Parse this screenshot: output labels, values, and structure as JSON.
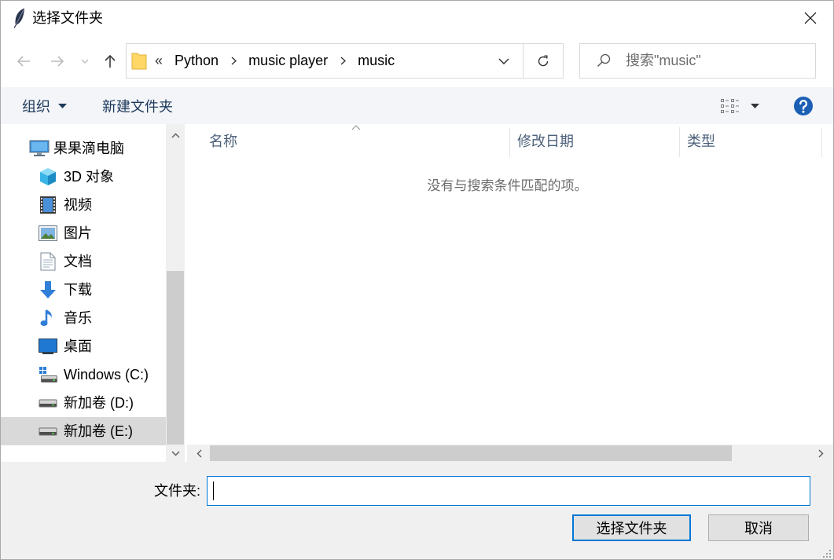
{
  "window": {
    "title": "选择文件夹"
  },
  "address": {
    "overflow": "«",
    "crumbs": [
      "Python",
      "music player",
      "music"
    ]
  },
  "search": {
    "placeholder": "搜索\"music\""
  },
  "toolbar": {
    "organize": "组织",
    "new_folder": "新建文件夹"
  },
  "nav": {
    "items": [
      {
        "label": "果果滴电脑",
        "icon": "computer-icon"
      },
      {
        "label": "3D 对象",
        "icon": "3d-objects-icon"
      },
      {
        "label": "视频",
        "icon": "videos-icon"
      },
      {
        "label": "图片",
        "icon": "pictures-icon"
      },
      {
        "label": "文档",
        "icon": "documents-icon"
      },
      {
        "label": "下载",
        "icon": "downloads-icon"
      },
      {
        "label": "音乐",
        "icon": "music-icon"
      },
      {
        "label": "桌面",
        "icon": "desktop-icon"
      },
      {
        "label": "Windows (C:)",
        "icon": "system-drive-icon"
      },
      {
        "label": "新加卷 (D:)",
        "icon": "drive-icon"
      },
      {
        "label": "新加卷 (E:)",
        "icon": "drive-icon",
        "selected": true
      }
    ]
  },
  "file_list": {
    "columns": [
      "名称",
      "修改日期",
      "类型"
    ],
    "empty_message": "没有与搜索条件匹配的项。"
  },
  "footer": {
    "folder_label": "文件夹:",
    "folder_value": "",
    "select_button": "选择文件夹",
    "cancel_button": "取消"
  },
  "colors": {
    "accent": "#0078d7",
    "selection": "#d9d9d9",
    "command_text": "#1e395b",
    "help": "#1a5fb4",
    "folder": "#ffd766"
  }
}
